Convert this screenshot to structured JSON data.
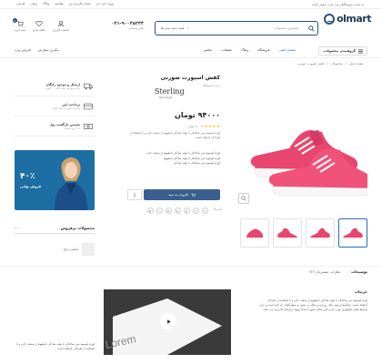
{
  "topbar": {
    "promo": "به سایت فروشگاهی وب مارت خوش آمدید",
    "links": [
      "ورود / ثبت نام",
      "حساب کاربری من",
      "مقایسه",
      "وبلاگ",
      "تومان",
      "فارسی"
    ]
  },
  "header": {
    "logo": "olmart",
    "search": {
      "placeholder": "جستجوی محصولات",
      "category": "همه دسته بندی ها"
    },
    "support": {
      "number": "۰۲۱-۹۰۰۴۵۲۳۴",
      "label": "تلفن پشتیبانی"
    },
    "icons": [
      {
        "name": "user-icon",
        "label": "حساب کاربری"
      },
      {
        "name": "heart-icon",
        "label": "علاقه مندی"
      },
      {
        "name": "cart-icon",
        "label": "سبد خرید",
        "badge": "0"
      }
    ]
  },
  "nav": {
    "categories": "گروهبندی محصولات",
    "items": [
      "صفحه اصلی",
      "فروشگاه",
      "وبلاگ",
      "صفحات",
      "عناصر"
    ],
    "right": [
      "پیگیری سفارش",
      "فروش ویژه"
    ]
  },
  "breadcrumb": [
    "صفحه اصلی",
    "محصولات",
    "کفش اسپورت صورتی"
  ],
  "product": {
    "title": "کفش اسپورت صورتی",
    "brand_label": "برند: اسپرلینگ",
    "brand_logo": "Sterling",
    "brand_sub": "Sport style",
    "price": "۹۴۰۰۰ تومان",
    "rating": 4,
    "review_count": "(۲ نظر)",
    "short_desc": "لورم ایپسوم متن ساختگی با تولید سادگی نامفهوم از صنعت چاپ و با استفاده از طراحان گرافیک است.",
    "bullets": [
      "لورم ایپسوم متن ساختگی با تولید سادگی نامفهوم از صنعت چاپ",
      "لورم ایپسوم متن ساختگی با تولید سادگی نامفهوم",
      "لورم ایپسوم متن ساختگی با تولید سادگی"
    ],
    "qty": "1",
    "add_to_cart": "افزودن به سبد",
    "share_label": "اشتراک:"
  },
  "sidebar": {
    "services": [
      {
        "title": "ارسال و موجود رایگان",
        "sub": "برای سفارش های بالای ۲۰۰ هزار"
      },
      {
        "title": "پرداخت امن",
        "sub": "پرداخت امن با درگاه بانکی"
      },
      {
        "title": "تضمین بازگشت پول",
        "sub": "تا ۷ روز ضمانت"
      }
    ],
    "banner": {
      "discount": "۴۰٪",
      "label": "فروش نهایی"
    },
    "best_title": "محصولات پرفروش",
    "best_item": "اسمارت واچ"
  },
  "tabs": [
    "توضیحات",
    "نظرات مشتریان (۲)"
  ],
  "details": {
    "title": "جزئیات",
    "text": "لورم ایپسوم متن ساختگی با تولید سادگی نامفهوم از صنعت چاپ و با استفاده از طراحان گرافیک است. چاپگرها و متون بلکه روزنامه و مجله در ستون و سطرآنچنان که لازم است و برای شرایط فعلی تکنولوژی مورد نیاز و کاربردهای متنوع با هدف بهبود ابزارهای کاربردی می باشد.",
    "text2": "لورم ایپسوم متن ساختگی با تولید سادگی نامفهوم از صنعت چاپ و با استفاده از طراحان گرافیک است.",
    "video_word": "Lorem"
  },
  "colors": {
    "accent": "#3a5f8e",
    "shoe": "#e8456f",
    "star": "#f4b400"
  }
}
